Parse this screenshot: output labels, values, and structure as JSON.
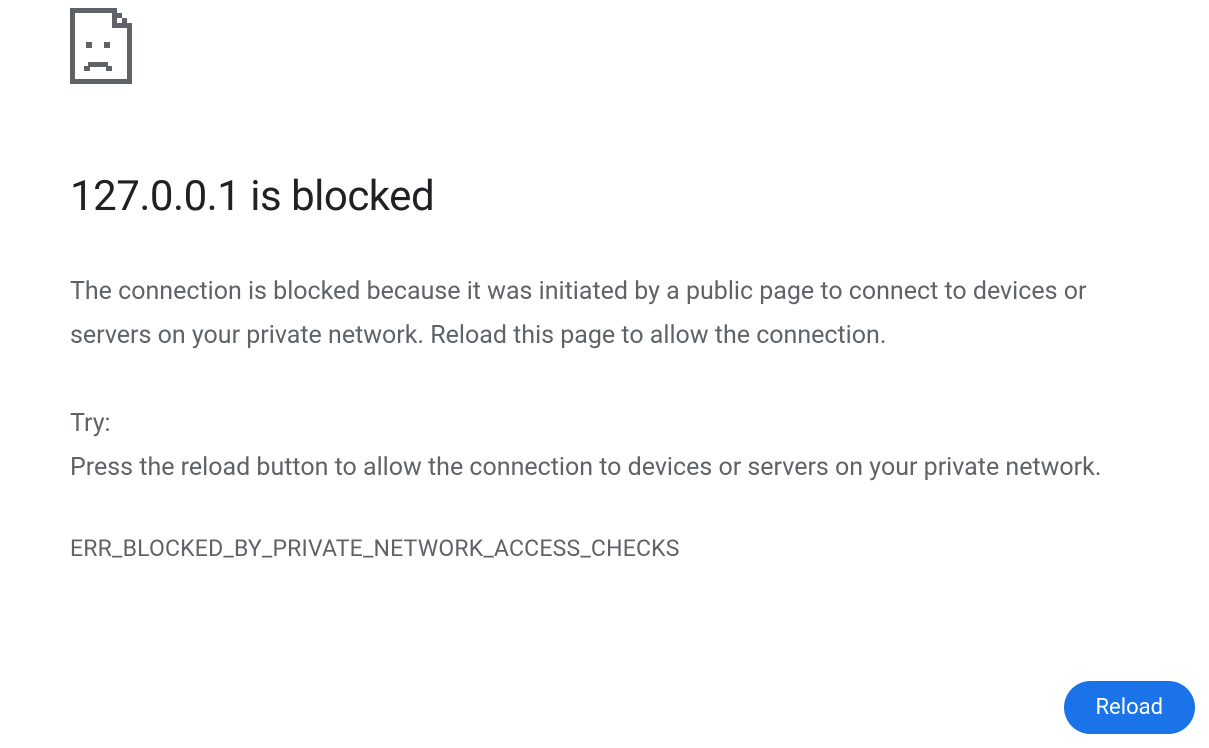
{
  "error": {
    "title": "127.0.0.1 is blocked",
    "description": "The connection is blocked because it was initiated by a public page to connect to devices or servers on your private network. Reload this page to allow the connection.",
    "try_label": "Try:",
    "try_suggestion": "Press the reload button to allow the connection to devices or servers on your private network.",
    "code": "ERR_BLOCKED_BY_PRIVATE_NETWORK_ACCESS_CHECKS"
  },
  "actions": {
    "reload_label": "Reload"
  },
  "icon": {
    "name": "sad-file-icon"
  }
}
